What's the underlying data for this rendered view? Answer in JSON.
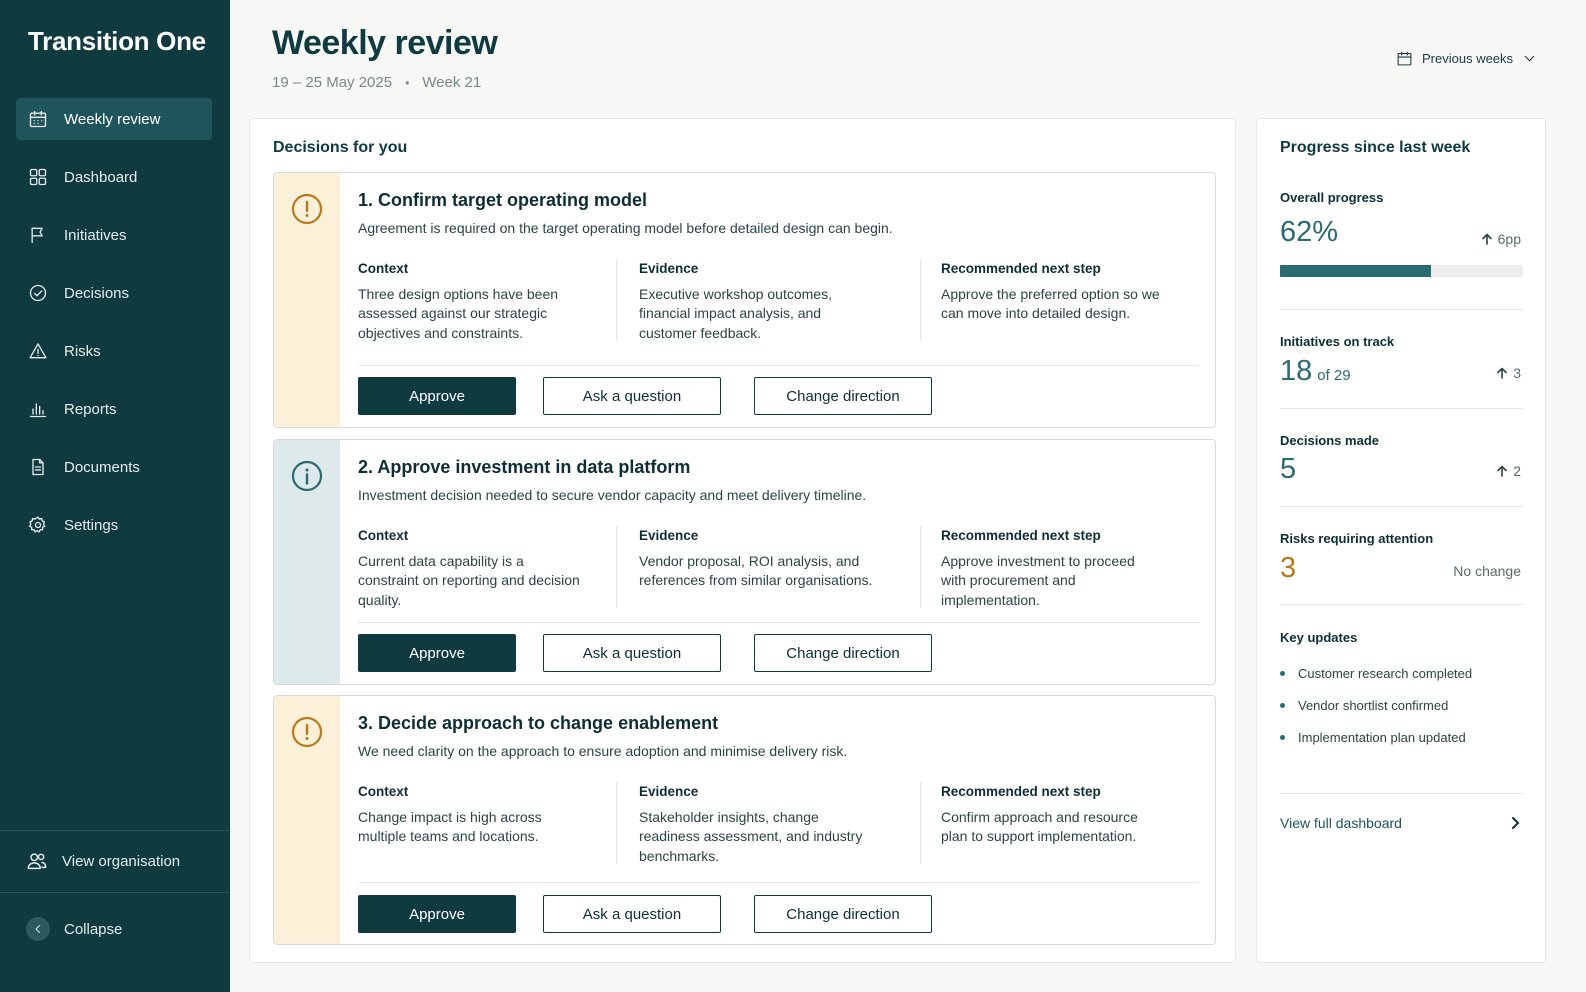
{
  "app": {
    "name": "Transition One"
  },
  "sidebar": {
    "items": [
      {
        "label": "Weekly review",
        "icon": "calendar-icon",
        "active": true
      },
      {
        "label": "Dashboard",
        "icon": "grid-icon"
      },
      {
        "label": "Initiatives",
        "icon": "flag-icon"
      },
      {
        "label": "Decisions",
        "icon": "check-circle-icon"
      },
      {
        "label": "Risks",
        "icon": "warning-icon"
      },
      {
        "label": "Reports",
        "icon": "bar-chart-icon"
      },
      {
        "label": "Documents",
        "icon": "document-icon"
      },
      {
        "label": "Settings",
        "icon": "gear-icon"
      }
    ],
    "view_organisation": "View organisation",
    "collapse": "Collapse"
  },
  "header": {
    "title": "Weekly review",
    "date_range": "19 – 25 May 2025",
    "week": "Week 21",
    "previous_weeks": "Previous weeks"
  },
  "decisions": {
    "title": "Decisions for you",
    "context_label": "Context",
    "evidence_label": "Evidence",
    "next_step_label": "Recommended next step",
    "approve_label": "Approve",
    "ask_label": "Ask a question",
    "change_label": "Change direction",
    "items": [
      {
        "title": "1. Confirm target operating model",
        "description": "Agreement is required on the target operating model before detailed design can begin.",
        "context": "Three design options have been assessed against our strategic objectives and constraints.",
        "evidence": "Executive workshop outcomes, financial impact analysis, and customer feedback.",
        "next_step": "Approve the preferred option so we can move into detailed design.",
        "kind": "warning",
        "icon": "alert-circle-icon"
      },
      {
        "title": "2. Approve investment in data platform",
        "description": "Investment decision needed to secure vendor capacity and meet delivery timeline.",
        "context": "Current data capability is a constraint on reporting and decision quality.",
        "evidence": "Vendor proposal, ROI analysis, and references from similar organisations.",
        "next_step": "Approve investment to proceed with procurement and implementation.",
        "kind": "info",
        "icon": "info-circle-icon"
      },
      {
        "title": "3. Decide approach to change enablement",
        "description": "We need clarity on the approach to ensure adoption and minimise delivery risk.",
        "context": "Change impact is high across multiple teams and locations.",
        "evidence": "Stakeholder insights, change readiness assessment, and industry benchmarks.",
        "next_step": "Confirm approach and resource plan to support implementation.",
        "kind": "warning",
        "icon": "alert-circle-icon"
      }
    ]
  },
  "progress": {
    "title": "Progress since last week",
    "overall": {
      "label": "Overall progress",
      "value": "62%",
      "fraction": 0.62,
      "delta": "6pp"
    },
    "initiatives": {
      "label": "Initiatives on track",
      "value": "18",
      "suffix": "of 29",
      "delta": "3"
    },
    "decisions_made": {
      "label": "Decisions made",
      "value": "5",
      "delta": "2"
    },
    "risks": {
      "label": "Risks requiring attention",
      "value": "3",
      "delta": "No change"
    },
    "key_updates": {
      "label": "Key updates",
      "items": [
        "Customer research completed",
        "Vendor shortlist confirmed",
        "Implementation plan updated"
      ]
    },
    "view_full": "View full dashboard"
  },
  "colors": {
    "sidebar_bg": "#0f3a40",
    "primary": "#0f3a40",
    "accent_teal": "#2a6b72",
    "warning_amber": "#b67a1a",
    "warning_bg": "#fdf0d8",
    "info_bg": "#dde9ea"
  }
}
